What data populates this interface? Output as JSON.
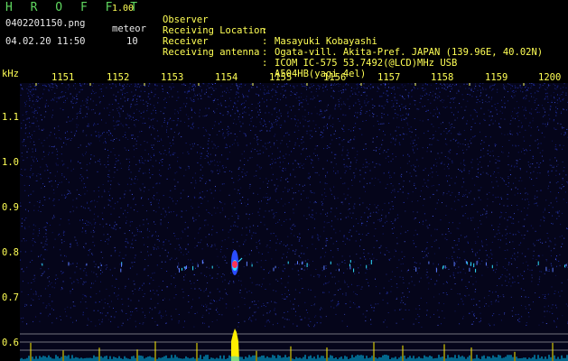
{
  "app": {
    "name": "H R O F F T",
    "version": "1.00"
  },
  "capture": {
    "filename": "0402201150.png",
    "datetime": "04.02.20 11:50",
    "meteor_label": "meteor",
    "meteor_count": "10"
  },
  "station": {
    "rows": [
      {
        "label": "Observer",
        "value": "Masayuki Kobayashi"
      },
      {
        "label": "Receiving Location",
        "value": "Ogata-vill. Akita-Pref. JAPAN (139.96E, 40.02N)"
      },
      {
        "label": "Receiver",
        "value": "ICOM IC-575 53.7492(@LCD)MHz USB"
      },
      {
        "label": "Receiving antenna",
        "value": "A504HB(yagi 4el)"
      }
    ],
    "separator": ":"
  },
  "axes": {
    "y_unit": "kHz",
    "x_ticks": [
      "1151",
      "1152",
      "1153",
      "1154",
      "1155",
      "1156",
      "1157",
      "1158",
      "1159",
      "1200"
    ],
    "y_ticks": [
      "1.1",
      "1.0",
      "0.9",
      "0.8",
      "0.7",
      "0.6"
    ]
  },
  "colors": {
    "header_green": "#5fd75f",
    "label_yellow": "#ffff55",
    "noise_blue": "#2a3cc8",
    "echo_red": "#ff3355",
    "echo_cyan": "#30e0ff",
    "baseline_cyan": "#00c8ff",
    "echo_yellow": "#ffee00"
  },
  "meteor_echoes": [
    {
      "time": "11:54",
      "freq_khz": 0.78,
      "strength": "strong"
    }
  ]
}
